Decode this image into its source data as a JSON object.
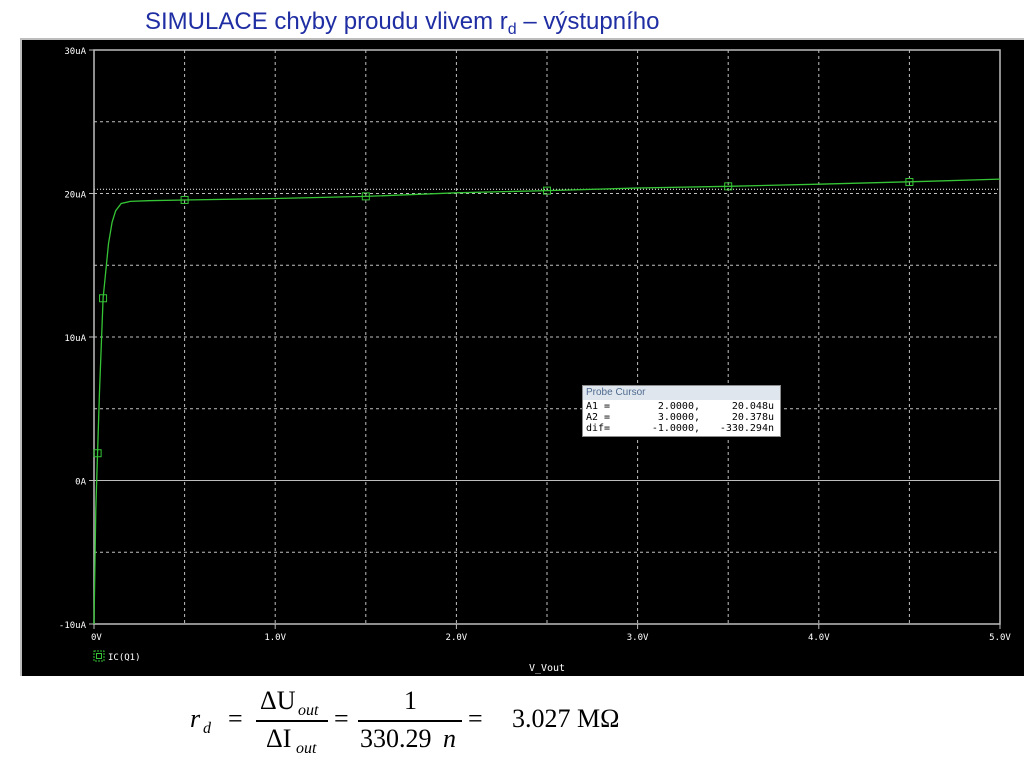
{
  "slide": {
    "title_main": "SIMULACE chyby proudu vlivem r",
    "title_sub": "d",
    "title_tail": " – výstupního"
  },
  "colors": {
    "background": "#000000",
    "grid": "#ffffff",
    "trace": "#35c435",
    "axis_text": "#ffffff"
  },
  "chart_data": {
    "type": "line",
    "xlabel": "V_Vout",
    "ylabel": "",
    "xlim": [
      0,
      5
    ],
    "ylim": [
      -10,
      30
    ],
    "x_ticks": [
      0,
      1,
      2,
      3,
      4,
      5
    ],
    "x_tick_labels": [
      "0V",
      "1.0V",
      "2.0V",
      "3.0V",
      "4.0V",
      "5.0V"
    ],
    "y_ticks": [
      -10,
      0,
      10,
      20,
      30
    ],
    "y_tick_labels": [
      "-10uA",
      "0A",
      "10uA",
      "20uA",
      "30uA"
    ],
    "grid": true,
    "legend": [
      "IC(Q1)"
    ],
    "legend_position": "bottom-left",
    "series": [
      {
        "name": "IC(Q1)",
        "x": [
          0,
          0.01,
          0.02,
          0.03,
          0.05,
          0.08,
          0.1,
          0.12,
          0.15,
          0.2,
          0.3,
          0.5,
          1.0,
          1.5,
          2.0,
          2.5,
          3.0,
          3.5,
          4.0,
          4.6,
          5.0
        ],
        "y": [
          -10,
          -2,
          2,
          6,
          12.7,
          16.5,
          18,
          18.8,
          19.3,
          19.45,
          19.5,
          19.55,
          19.65,
          19.8,
          20.05,
          20.2,
          20.38,
          20.5,
          20.65,
          20.85,
          21.0
        ],
        "markers_x": [
          0.02,
          0.05,
          0.5,
          1.5,
          2.5,
          3.5,
          4.5
        ],
        "markers_y": [
          1.9,
          12.7,
          19.55,
          19.8,
          20.2,
          20.5,
          20.8
        ]
      }
    ],
    "cursor_line_y": 20.3
  },
  "probe_cursor": {
    "title": "Probe Cursor",
    "rows": [
      {
        "label": "A1 =",
        "x": "2.0000,",
        "y": "20.048u"
      },
      {
        "label": "A2 =",
        "x": "3.0000,",
        "y": "20.378u"
      },
      {
        "label": "dif=",
        "x": "-1.0000,",
        "y": "-330.294n"
      }
    ]
  },
  "formula": {
    "lhs": "r",
    "lhs_sub": "d",
    "eq": "=",
    "num1": "ΔU",
    "num1_sub": "out",
    "den1": "ΔI",
    "den1_sub": "out",
    "num2": "1",
    "den2": "330.29",
    "den2_unit": "n",
    "result": "3.027 MΩ"
  }
}
